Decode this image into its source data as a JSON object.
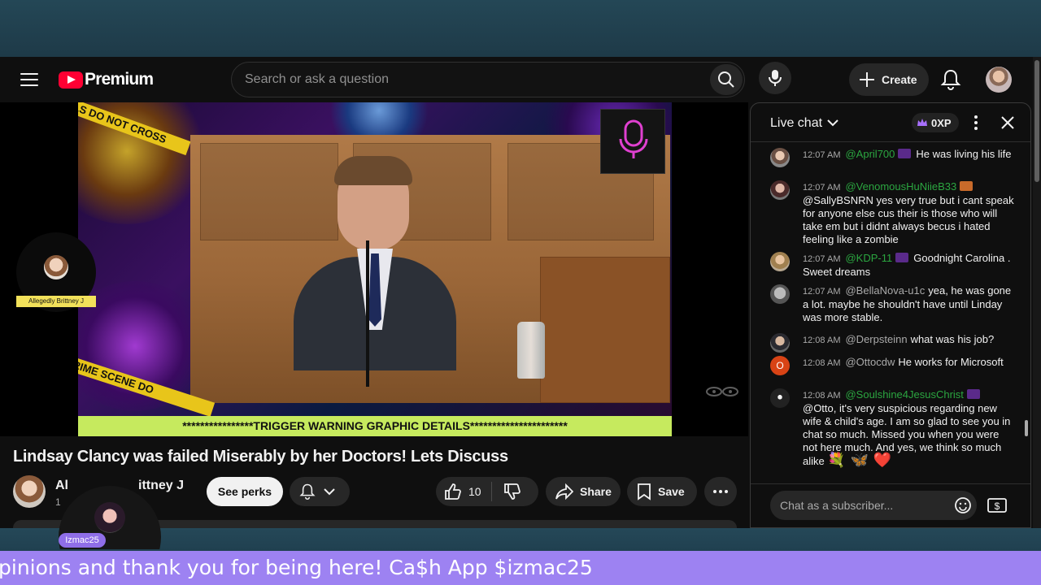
{
  "header": {
    "logo_text": "Premium",
    "search_placeholder": "Search or ask a question",
    "create_label": "Create"
  },
  "video": {
    "warning_banner": "****************TRIGGER WARNING GRAPHIC DETAILS**********************",
    "host_overlay_name": "Allegedly Brittney J",
    "tape_top": "LS DO NOT CROSS",
    "tape_bottom": "CRIME SCENE DO",
    "title": "Lindsay Clancy was failed Miserably by her Doctors! Lets Discuss"
  },
  "owner": {
    "channel_name_left": "Al",
    "channel_name_right": "ittney J",
    "subs_prefix": "1",
    "perks_label": "See perks"
  },
  "actions": {
    "like_count": "10",
    "share_label": "Share",
    "save_label": "Save"
  },
  "chat": {
    "title": "Live chat",
    "xp": "0XP",
    "input_placeholder": "Chat as a subscriber...",
    "messages": [
      {
        "time": "12:07 AM",
        "author": "@April700",
        "text": "He was living his life",
        "member": true
      },
      {
        "time": "12:07 AM",
        "author": "@VenomousHuNiieB33",
        "text": "@SallyBSNRN yes very true but i cant speak for anyone else cus their is those who will take em but i didnt always becus i hated feeling like a zombie",
        "member": true
      },
      {
        "time": "12:07 AM",
        "author": "@KDP-11",
        "text": "Goodnight Carolina . Sweet dreams",
        "member": true
      },
      {
        "time": "12:07 AM",
        "author": "@BellaNova-u1c",
        "text": "yea, he was gone a lot. maybe he shouldn't have until Linday was more stable.",
        "member": false
      },
      {
        "time": "12:08 AM",
        "author": "@Derpsteinn",
        "text": "what was his job?",
        "member": false
      },
      {
        "time": "12:08 AM",
        "author": "@Ottocdw",
        "text": "He works for Microsoft",
        "member": false
      },
      {
        "time": "12:08 AM",
        "author": "@Soulshine4JesusChrist",
        "text": "@Otto, it's very suspicious regarding new wife & child's age. I am so glad to see you in chat so much. Missed you when you were not here much. And yes, we think so much alike",
        "member": true,
        "emoji": "💐 🦋 ❤️"
      }
    ],
    "avatar_letter_o": "O"
  },
  "stream_overlay": {
    "guest_tag": "Izmac25",
    "ticker_text": "pinions and thank you for being here! Ca$h App $izmac25"
  },
  "colors": {
    "accent_red": "#ff0033",
    "member_green": "#2ba640",
    "ticker_purple": "#9d82f2",
    "warning_green": "#c6ea5e"
  }
}
